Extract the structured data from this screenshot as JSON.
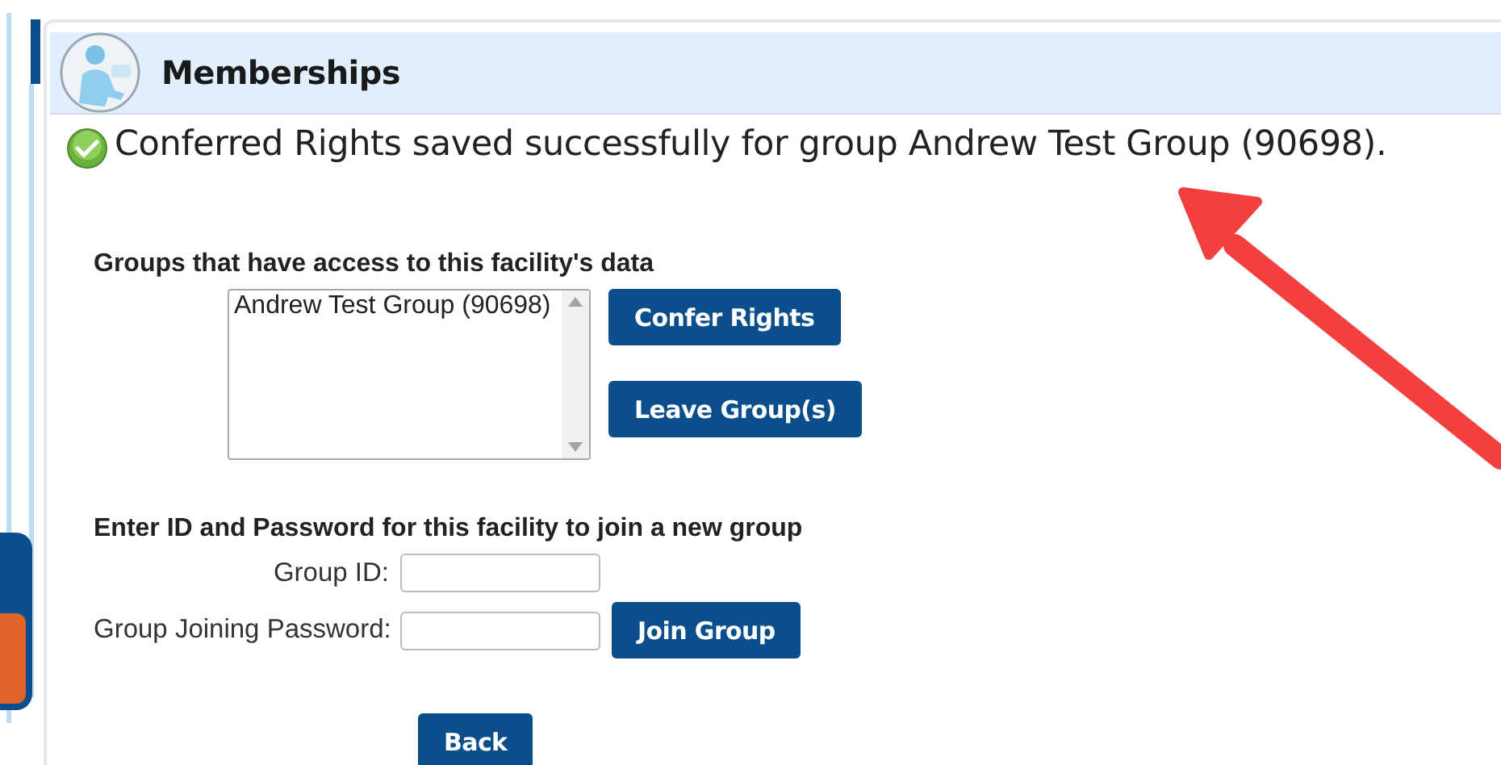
{
  "header": {
    "title": "Memberships"
  },
  "message": {
    "text": "Conferred Rights saved successfully for group Andrew Test Group (90698)."
  },
  "groups_section": {
    "label": "Groups that have access to this facility's data",
    "groups": [
      {
        "name": "Andrew Test Group (90698)"
      }
    ],
    "buttons": [
      "Confer Rights",
      "Leave Group(s)"
    ]
  },
  "join_section": {
    "label": "Enter ID and Password for this facility to join a new group",
    "fields": [
      {
        "label": "Group ID:"
      },
      {
        "label": "Group Joining Password:"
      }
    ],
    "button": "Join Group"
  },
  "back_button": "Back"
}
